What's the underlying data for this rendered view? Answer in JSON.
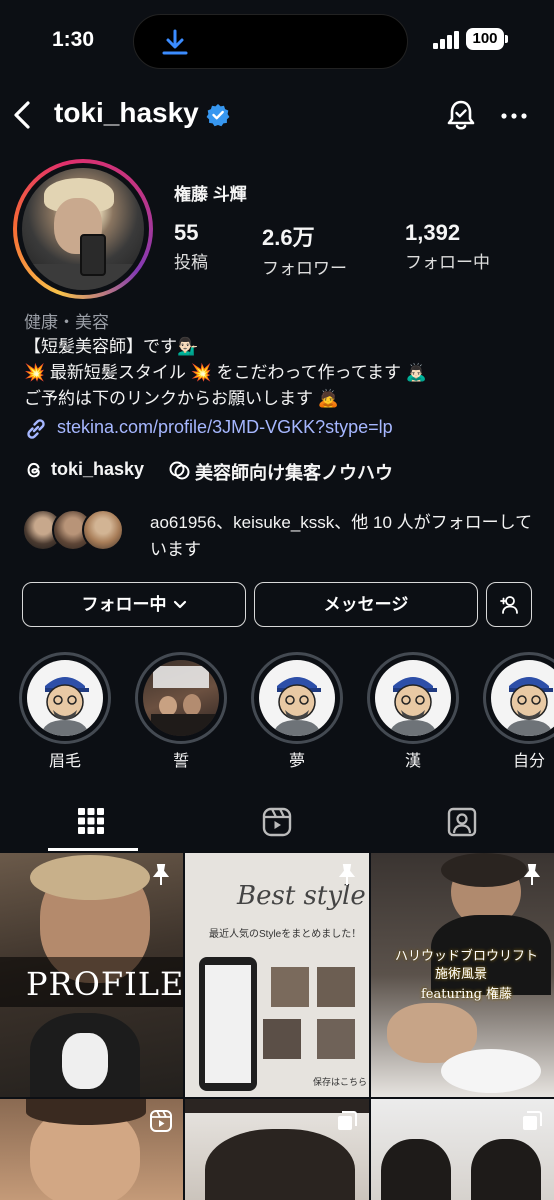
{
  "status_bar": {
    "time": "1:30",
    "battery": "100"
  },
  "header": {
    "username": "toki_hasky"
  },
  "profile": {
    "full_name": "権藤 斗輝",
    "stats": [
      {
        "value": "55",
        "label": "投稿"
      },
      {
        "value": "2.6万",
        "label": "フォロワー"
      },
      {
        "value": "1,392",
        "label": "フォロー中"
      }
    ],
    "category": "健康・美容",
    "bio_lines": [
      "【短髪美容師】です💁🏻‍♂️",
      "💥 最新短髪スタイル 💥 をこだわって作ってます 🙇🏻‍♂️",
      "ご予約は下のリンクからお願いします 🙇"
    ],
    "link": "stekina.com/profile/3JMD-VGKK?stype=lp",
    "threads_handle": "toki_hasky",
    "guide_label": "美容師向け集客ノウハウ",
    "mutual_followers_text": "ao61956、keisuke_kssk、他 10 人がフォローしています"
  },
  "actions": {
    "following_label": "フォロー中",
    "message_label": "メッセージ"
  },
  "highlights": [
    {
      "label": "眉毛"
    },
    {
      "label": "誓"
    },
    {
      "label": "夢"
    },
    {
      "label": "漢"
    },
    {
      "label": "自分"
    }
  ],
  "grid": {
    "posts": [
      {
        "overlay": "PROFILE"
      },
      {
        "title": "Best style",
        "subtitle": "最近人気のStyleをまとめました！",
        "footer": "保存はこちら→"
      },
      {
        "overlay": "ハリウッドブロウリフト",
        "overlay2": "施術風景",
        "overlay3": "featuring 権藤"
      }
    ]
  },
  "colors": {
    "background": "#0c0f14",
    "link": "#a6b7ff",
    "verified": "#3797f0"
  }
}
